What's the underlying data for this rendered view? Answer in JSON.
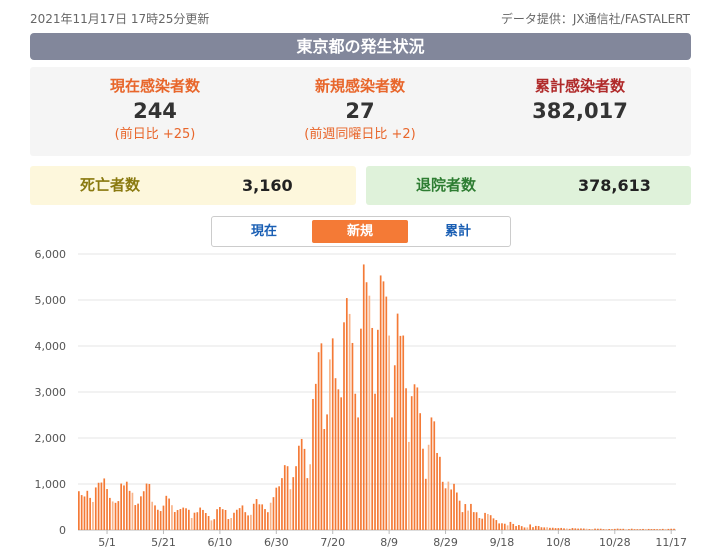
{
  "header": {
    "updated": "2021年11月17日 17時25分更新",
    "source": "データ提供：JX通信社/FASTALERT"
  },
  "title": "東京都の発生状況",
  "stats": {
    "current": {
      "label": "現在感染者数",
      "value": "244",
      "sub": "(前日比 +25)"
    },
    "new": {
      "label": "新規感染者数",
      "value": "27",
      "sub": "(前週同曜日比 +2)"
    },
    "total": {
      "label": "累計感染者数",
      "value": "382,017"
    }
  },
  "deaths": {
    "label": "死亡者数",
    "value": "3,160"
  },
  "recovered": {
    "label": "退院者数",
    "value": "378,613"
  },
  "tabs": [
    "現在",
    "新規",
    "累計"
  ],
  "active_tab": "新規",
  "colors": {
    "bar": "#f47a36",
    "bar_light": "#f8b48a",
    "title_bg": "#82879b"
  },
  "chart_data": {
    "type": "bar",
    "ylim": [
      0,
      6000
    ],
    "yticks": [
      "0",
      "1,000",
      "2,000",
      "3,000",
      "4,000",
      "5,000",
      "6,000"
    ],
    "xticks": [
      "5/1",
      "5/21",
      "6/10",
      "6/30",
      "7/20",
      "8/9",
      "8/29",
      "9/18",
      "10/8",
      "10/28",
      "11/17"
    ],
    "start_date": "2021-04-21",
    "values": [
      843,
      759,
      729,
      852,
      698,
      609,
      925,
      1027,
      1032,
      1121,
      890,
      698,
      621,
      591,
      628,
      1010,
      969,
      1050,
      851,
      810,
      542,
      573,
      732,
      843,
      1010,
      1000,
      614,
      535,
      440,
      412,
      530,
      743,
      684,
      539,
      391,
      434,
      456,
      487,
      472,
      439,
      260,
      376,
      387,
      488,
      436,
      369,
      304,
      209,
      235,
      452,
      500,
      453,
      435,
      238,
      260,
      375,
      440,
      476,
      534,
      388,
      317,
      330,
      570,
      673,
      559,
      557,
      455,
      387,
      593,
      714,
      920,
      950,
      1128,
      1410,
      1387,
      886,
      1149,
      1387,
      1832,
      1979,
      1763,
      1128,
      1429,
      2848,
      3177,
      3865,
      4058,
      2195,
      2513,
      3709,
      4166,
      3300,
      3058,
      2884,
      4515,
      5042,
      4697,
      4066,
      2962,
      2447,
      4377,
      5773,
      5386,
      5094,
      4392,
      2962,
      4352,
      5534,
      5405,
      5074,
      4227,
      2447,
      3581,
      4704,
      4220,
      4228,
      3081,
      1915,
      2909,
      3168,
      3099,
      2539,
      1767,
      1113,
      1853,
      2447,
      2362,
      1674,
      1591,
      1048,
      906,
      1052,
      881,
      1004,
      815,
      637,
      389,
      564,
      422,
      567,
      389,
      386,
      260,
      246,
      372,
      348,
      322,
      253,
      216,
      143,
      146,
      136,
      101,
      176,
      132,
      86,
      108,
      84,
      56,
      56,
      121,
      62,
      89,
      86,
      60,
      57,
      60,
      47,
      49,
      41,
      41,
      45,
      36,
      33,
      25,
      43,
      36,
      31,
      34,
      32,
      28,
      20,
      13,
      30,
      28,
      28,
      18,
      21,
      21,
      17,
      24,
      30,
      25,
      26,
      16,
      19,
      28,
      18,
      18,
      18,
      23,
      22,
      23,
      20,
      21,
      18,
      17,
      24,
      20,
      24,
      27,
      27
    ]
  }
}
